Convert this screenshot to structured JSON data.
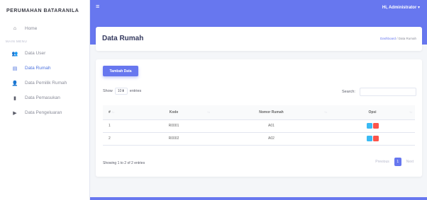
{
  "sidebar": {
    "brand": "PERUMAHAN BATARANILA",
    "home": {
      "label": "Home",
      "icon": "home-icon"
    },
    "menu_header": "MAIN MENU",
    "items": [
      {
        "label": "Data User",
        "icon": "users-icon"
      },
      {
        "label": "Data Rumah",
        "icon": "building-icon",
        "active": true
      },
      {
        "label": "Data Pemilik Rumah",
        "icon": "user-plus-icon"
      },
      {
        "label": "Data Pemasukan",
        "icon": "file-icon"
      },
      {
        "label": "Data Pengeluaran",
        "icon": "folder-icon"
      }
    ]
  },
  "topbar": {
    "user_greeting": "Hi, Administrator"
  },
  "header": {
    "title": "Data Rumah",
    "breadcrumb_link": "Dashboard",
    "breadcrumb_current": "Data Rumah"
  },
  "main": {
    "add_button": "Tambah Data",
    "show_label": "Show",
    "entries_value": "10",
    "entries_label": "entries",
    "search_label": "Search:",
    "columns": [
      "#",
      "Kode",
      "Nomor Rumah",
      "Opsi"
    ],
    "rows": [
      {
        "no": "1",
        "kode": "R0001",
        "nomor": "A01"
      },
      {
        "no": "2",
        "kode": "R0002",
        "nomor": "A02"
      }
    ],
    "info": "Showing 1 to 2 of 2 entries",
    "pager": {
      "prev": "Previous",
      "current": "1",
      "next": "Next"
    }
  },
  "colors": {
    "primary": "#6777ef",
    "edit": "#3abaf4",
    "delete": "#fc544b"
  }
}
